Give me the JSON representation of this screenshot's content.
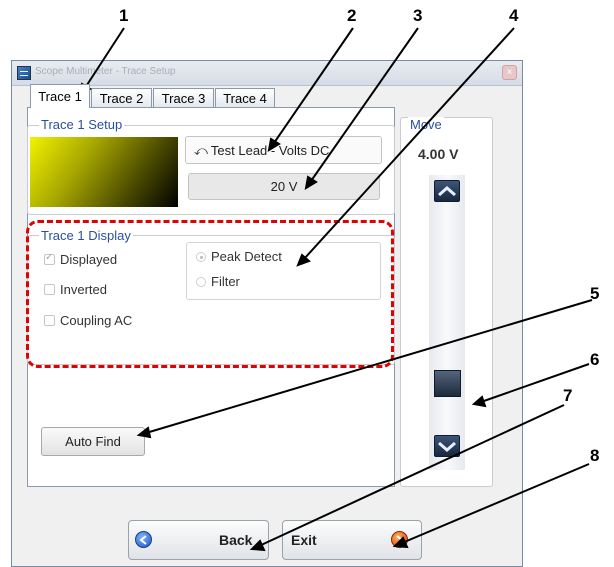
{
  "window": {
    "title": "Scope Multimeter - Trace Setup",
    "close_glyph": "×"
  },
  "tabs": [
    {
      "label": "Trace 1",
      "active": true
    },
    {
      "label": "Trace 2",
      "active": false
    },
    {
      "label": "Trace 3",
      "active": false
    },
    {
      "label": "Trace 4",
      "active": false
    }
  ],
  "setup": {
    "legend": "Trace 1 Setup",
    "lead_icon": "⤺",
    "lead_label": "Test Lead - Volts DC",
    "scale_value": "20 V",
    "swatch_color": "#f0f000"
  },
  "display": {
    "legend": "Trace 1 Display",
    "checkboxes": [
      {
        "label": "Displayed",
        "checked": true
      },
      {
        "label": "Inverted",
        "checked": false
      },
      {
        "label": "Coupling AC",
        "checked": false
      }
    ],
    "options": [
      {
        "label": "Peak Detect",
        "selected": true
      },
      {
        "label": "Filter",
        "selected": false
      }
    ]
  },
  "auto_find_label": "Auto Find",
  "move": {
    "legend": "Move",
    "value": "4.00 V",
    "up_icon": "chevron-up-icon",
    "down_icon": "chevron-down-icon"
  },
  "footer": {
    "back_label": "Back",
    "exit_label": "Exit"
  },
  "callouts": [
    "1",
    "2",
    "3",
    "4",
    "5",
    "6",
    "7",
    "8"
  ],
  "colors": {
    "accent_red": "#e20000",
    "legend_blue": "#2a4fa0",
    "navy_button": "#1c2c44"
  }
}
